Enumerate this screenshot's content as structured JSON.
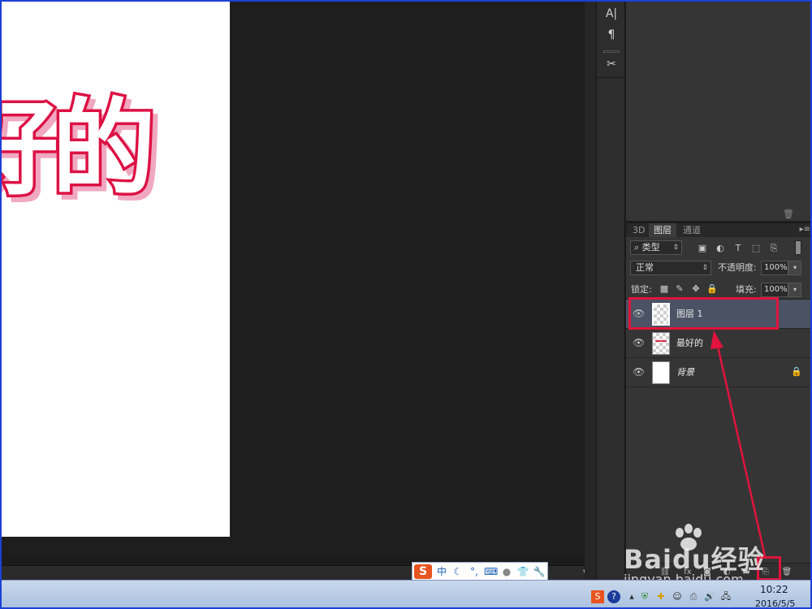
{
  "canvas": {
    "document_text": "好的",
    "text_stroke_color": "#dd1144"
  },
  "icon_column": {
    "items": [
      "character-icon",
      "paragraph-icon",
      "tools-icon"
    ],
    "labels": [
      "A|",
      "¶",
      "✂"
    ]
  },
  "layers_panel": {
    "tabs": [
      {
        "label": "3D",
        "active": false
      },
      {
        "label": "图层",
        "active": true
      },
      {
        "label": "通道",
        "active": false
      }
    ],
    "filter": {
      "label": "类型"
    },
    "blend_mode": "正常",
    "opacity_label": "不透明度:",
    "opacity_value": "100%",
    "lock_label": "锁定:",
    "fill_label": "填充:",
    "fill_value": "100%",
    "layers": [
      {
        "name": "图层 1",
        "selected": true,
        "visible": true
      },
      {
        "name": "最好的",
        "selected": false,
        "visible": true
      },
      {
        "name": "背景",
        "selected": false,
        "visible": true,
        "locked": true
      }
    ]
  },
  "ime": {
    "logo": "S",
    "mode": "中",
    "items": [
      "moon-icon",
      "punct-icon",
      "keyboard-icon",
      "user-icon",
      "shirt-icon",
      "wrench-icon"
    ]
  },
  "taskbar": {
    "time": "10:22",
    "date": "2016/5/5"
  },
  "watermark": {
    "text": "Baidu经验",
    "url": "jingyan.baidu.com"
  },
  "colors": {
    "annotation": "#e0143c",
    "selection": "#4a5264",
    "border": "#1d40d8"
  }
}
